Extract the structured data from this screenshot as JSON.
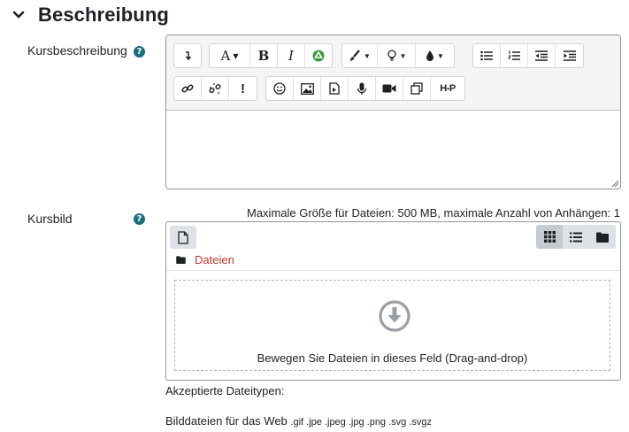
{
  "section": {
    "title": "Beschreibung"
  },
  "description": {
    "label": "Kursbeschreibung",
    "help": "?",
    "toolbar_icons": {
      "row1": [
        "collapse-icon",
        "font-icon",
        "bold-icon",
        "italic-icon",
        "accessibility-icon",
        "brush-icon",
        "bulb-icon",
        "drop-icon",
        "unordered-list-icon",
        "ordered-list-icon",
        "outdent-icon",
        "indent-icon"
      ],
      "row2": [
        "link-icon",
        "unlink-icon",
        "exclamation-icon",
        "emoji-icon",
        "image-icon",
        "media-icon",
        "microphone-icon",
        "video-icon",
        "copy-icon",
        "h5p-icon"
      ]
    },
    "toolbar_text": {
      "bold": "B",
      "italic": "I",
      "font": "A",
      "exclamation": "!",
      "h5p": "H-P"
    },
    "content": ""
  },
  "course_image": {
    "label": "Kursbild",
    "help": "?",
    "max_info": "Maximale Größe für Dateien: 500 MB, maximale Anzahl von Anhängen: 1",
    "path_label": "Dateien",
    "drop_text": "Bewegen Sie Dateien in dieses Feld (Drag-and-drop)",
    "view_modes": [
      "grid-view-icon",
      "list-view-icon",
      "folder-view-icon"
    ],
    "active_view": "grid-view-icon"
  },
  "accepted": {
    "label": "Akzeptierte Dateitypen:",
    "types_label": "Bilddateien für das Web",
    "extensions": ".gif .jpe .jpeg .jpg .png .svg .svgz"
  },
  "colors": {
    "link_red": "#c0392b",
    "help_teal": "#1a6e7a"
  }
}
